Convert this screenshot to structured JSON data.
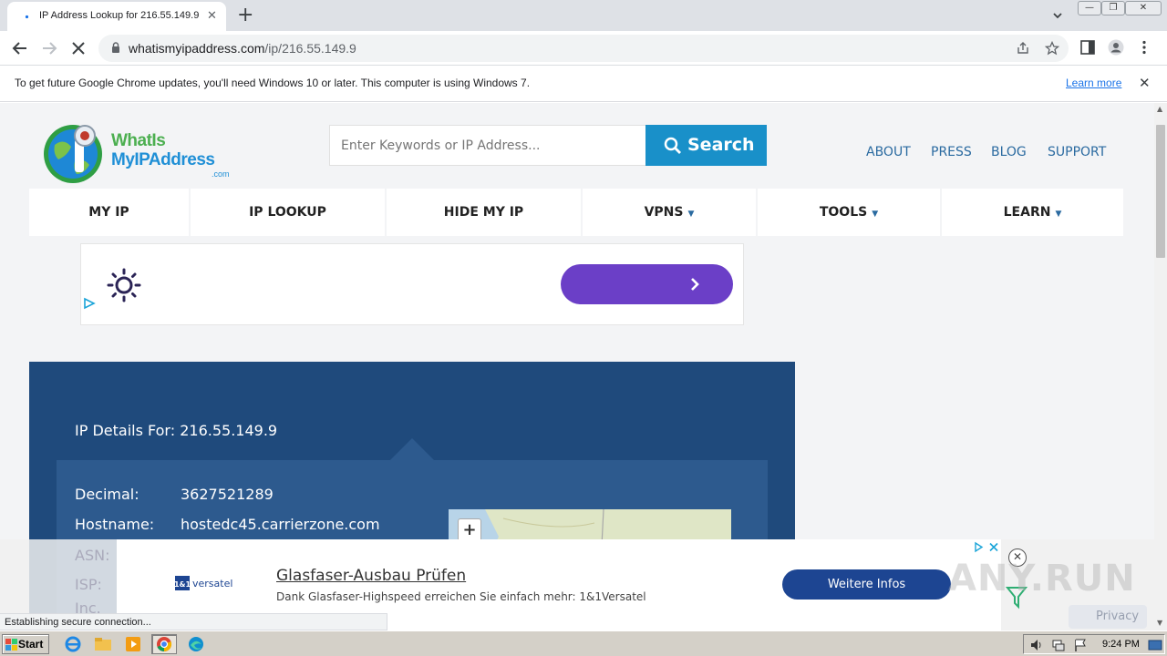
{
  "browser": {
    "tab_title": "IP Address Lookup for 216.55.149.9",
    "tab_close": "✕",
    "new_tab": "+",
    "url_host": "whatismyipaddress.com",
    "url_path": "/ip/216.55.149.9",
    "infobar_text": "To get future Google Chrome updates, you'll need Windows 10 or later. This computer is using Windows 7.",
    "infobar_link": "Learn more",
    "infobar_close": "✕",
    "status_text": "Establishing secure connection..."
  },
  "site": {
    "logo_word1": "WhatIs",
    "logo_word2": "MyIPAddress",
    "logo_com": ".com",
    "search_placeholder": "Enter Keywords or IP Address...",
    "search_button": "Search",
    "top_links": [
      "ABOUT",
      "PRESS",
      "BLOG",
      "SUPPORT"
    ],
    "nav": [
      {
        "label": "MY IP",
        "caret": ""
      },
      {
        "label": "IP LOOKUP",
        "caret": ""
      },
      {
        "label": "HIDE MY IP",
        "caret": ""
      },
      {
        "label": "VPNS",
        "caret": "▼"
      },
      {
        "label": "TOOLS",
        "caret": "▼"
      },
      {
        "label": "LEARN",
        "caret": "▼"
      }
    ]
  },
  "details": {
    "title": "IP Details For: 216.55.149.9",
    "rows": [
      {
        "label": "Decimal:",
        "value": "3627521289"
      },
      {
        "label": "Hostname:",
        "value": "hostedc45.carrierzone.com"
      }
    ],
    "hidden_labels": [
      "ASN:",
      "ISP:",
      "Inc."
    ],
    "map_zoom": "+"
  },
  "bottom_ad": {
    "brand": "1&1 versatel",
    "headline": "Glasfaser-Ausbau Prüfen",
    "body": "Dank Glasfaser-Highspeed erreichen Sie einfach mehr: 1&1Versatel",
    "cta": "Weitere Infos",
    "close": "✕"
  },
  "overlay": {
    "watermark": "ANY.RUN",
    "privacy": "Privacy"
  },
  "taskbar": {
    "start": "Start",
    "time": "9:24 PM"
  },
  "colors": {
    "details_bg": "#1f4a7c",
    "search_btn": "#1990c9",
    "ad_button": "#6b3fc7",
    "ad_cta": "#1d4592"
  }
}
